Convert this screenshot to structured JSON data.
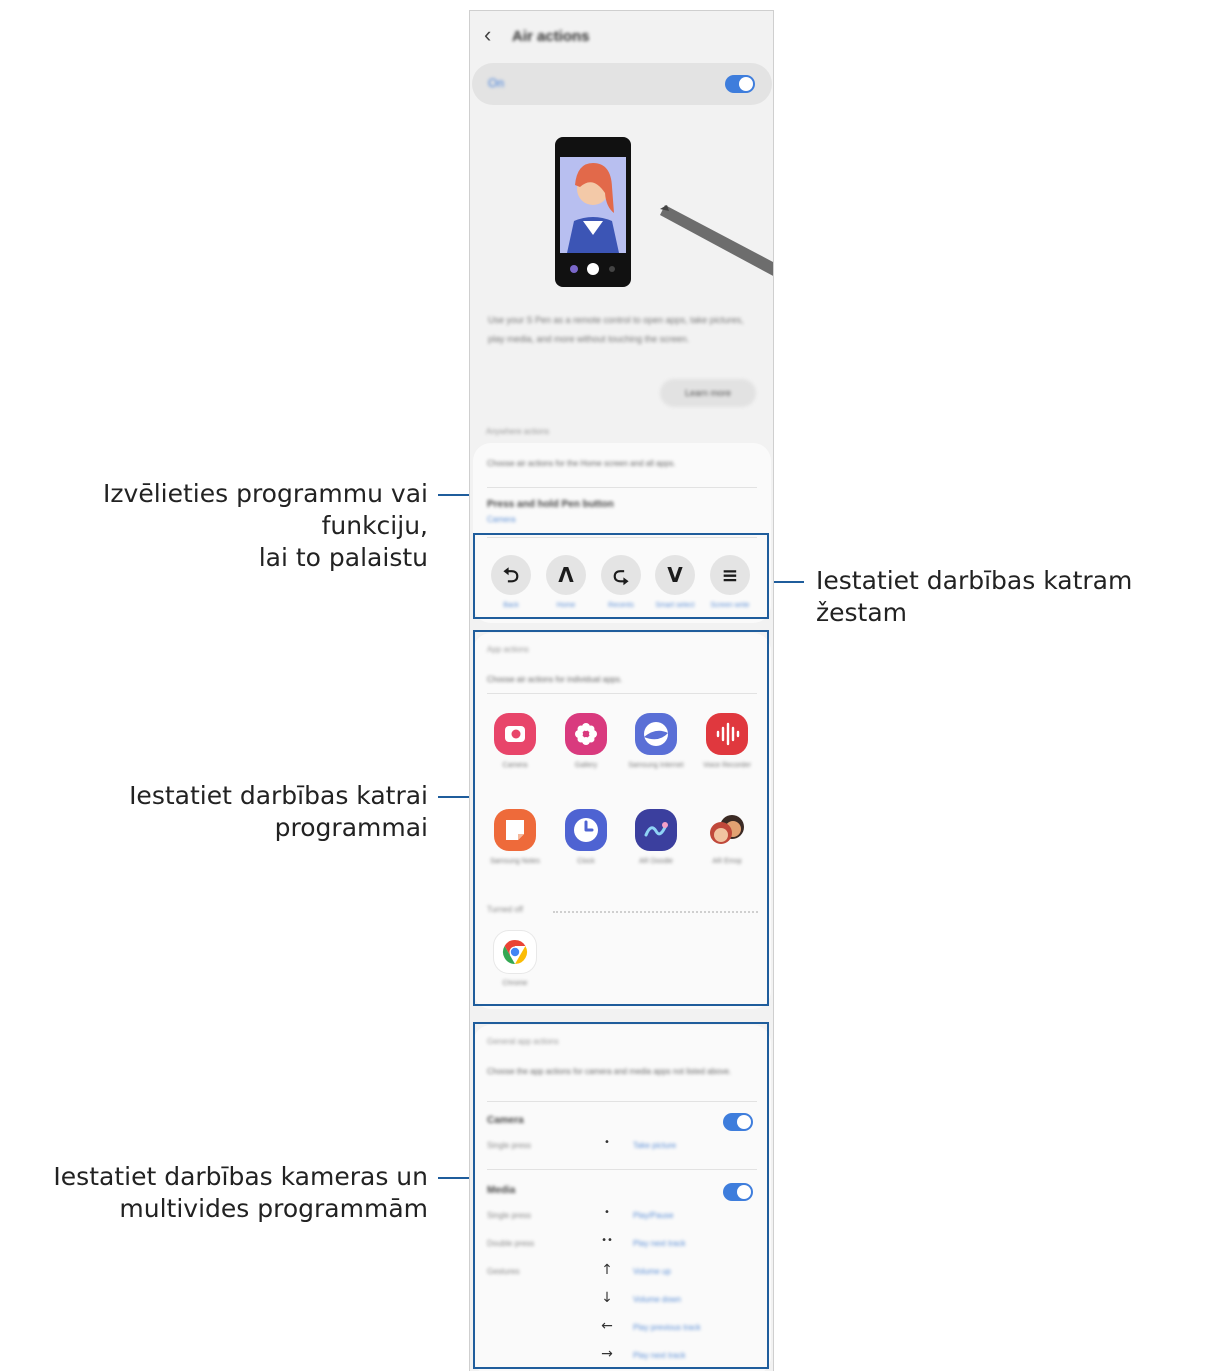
{
  "callouts": {
    "select_app": [
      "Izvēlieties programmu vai funkciju,",
      "lai to palaistu"
    ],
    "gestures": "Iestatiet darbības katram žestam",
    "app_actions": [
      "Iestatiet darbības katrai",
      "programmai"
    ],
    "camera_media": [
      "Iestatiet darbības kameras un",
      "multivides programmām"
    ]
  },
  "screen": {
    "title": "Air actions",
    "on_label": "On",
    "on_enabled": true,
    "description": "Use your S Pen as a remote control to open apps, take pictures, play media, and more without touching the screen.",
    "learn_more": "Learn more",
    "anywhere": {
      "header": "Anywhere actions",
      "subtitle": "Choose air actions for the Home screen and all apps.",
      "press_hold_title": "Press and hold Pen button",
      "press_hold_value": "Camera",
      "gestures": [
        {
          "icon": "back-gesture-icon",
          "glyph": "⮌",
          "label": "Back"
        },
        {
          "icon": "home-gesture-icon",
          "glyph": "Λ",
          "label": "Home"
        },
        {
          "icon": "recents-gesture-icon",
          "glyph": "⮎",
          "label": "Recents"
        },
        {
          "icon": "smart-select-gesture-icon",
          "glyph": "V",
          "label": "Smart select"
        },
        {
          "icon": "screen-write-gesture-icon",
          "glyph": "≡",
          "label": "Screen write"
        }
      ]
    },
    "app_actions": {
      "header": "App actions",
      "subtitle": "Choose air actions for individual apps.",
      "apps": [
        {
          "icon": "camera-app-icon",
          "label": "Camera",
          "color": "#e8456a"
        },
        {
          "icon": "gallery-app-icon",
          "label": "Gallery",
          "color": "#d93a7e"
        },
        {
          "icon": "samsung-internet-app-icon",
          "label": "Samsung Internet",
          "color": "#5a6fd6"
        },
        {
          "icon": "voice-recorder-app-icon",
          "label": "Voice Recorder",
          "color": "#e0383e"
        },
        {
          "icon": "samsung-notes-app-icon",
          "label": "Samsung Notes",
          "color": "#ee6a3a"
        },
        {
          "icon": "clock-app-icon",
          "label": "Clock",
          "color": "#4e63d2"
        },
        {
          "icon": "ar-doodle-app-icon",
          "label": "AR Doodle",
          "color": "#3b3f9e"
        },
        {
          "icon": "ar-emoji-app-icon",
          "label": "AR Emoji",
          "color": "#e06b4c"
        }
      ],
      "turned_off_label": "Turned off",
      "turned_off_apps": [
        {
          "icon": "chrome-app-icon",
          "label": "Chrome"
        }
      ]
    },
    "general": {
      "header": "General app actions",
      "subtitle": "Choose the app actions for camera and media apps not listed above.",
      "camera": {
        "title": "Camera",
        "enabled": true,
        "rows": [
          {
            "label": "Single press",
            "symbol": "•",
            "action": "Take picture"
          }
        ]
      },
      "media": {
        "title": "Media",
        "enabled": true,
        "rows": [
          {
            "label": "Single press",
            "symbol": "•",
            "action": "Play/Pause"
          },
          {
            "label": "Double press",
            "symbol": "••",
            "action": "Play next track"
          },
          {
            "label": "Gestures",
            "symbol": "↑",
            "action": "Volume up"
          },
          {
            "label": "",
            "symbol": "↓",
            "action": "Volume down"
          },
          {
            "label": "",
            "symbol": "←",
            "action": "Play previous track"
          },
          {
            "label": "",
            "symbol": "→",
            "action": "Play next track"
          }
        ]
      }
    }
  }
}
